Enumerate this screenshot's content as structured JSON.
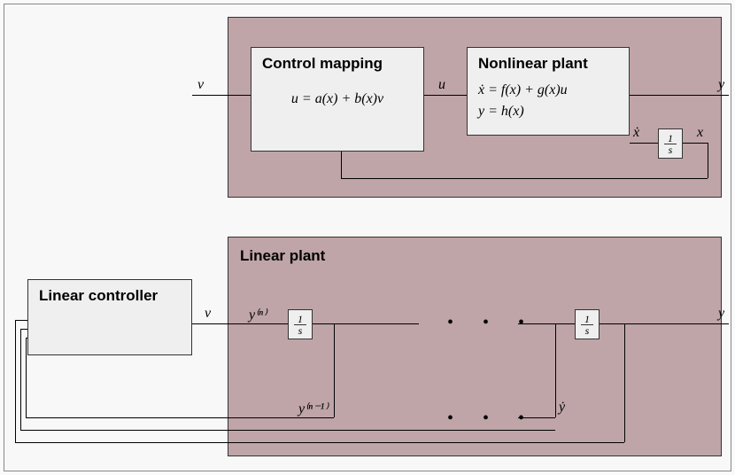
{
  "top_panel": {
    "control_mapping": {
      "title": "Control mapping",
      "equation": "u = a(x) + b(x)v"
    },
    "nonlinear_plant": {
      "title": "Nonlinear plant",
      "equation1": "ẋ = f(x) + g(x)u",
      "equation2": "y = h(x)"
    },
    "integrator": {
      "num": "1",
      "den": "s"
    },
    "signals": {
      "v": "v",
      "u": "u",
      "y": "y",
      "xdot": "ẋ",
      "x": "x"
    }
  },
  "bottom_panel": {
    "title": "Linear plant",
    "linear_controller": {
      "title": "Linear controller"
    },
    "integrator1": {
      "num": "1",
      "den": "s"
    },
    "integrator2": {
      "num": "1",
      "den": "s"
    },
    "signals": {
      "v": "v",
      "yn": "y⁽ⁿ⁾",
      "y": "y",
      "yn1": "y⁽ⁿ⁻¹⁾",
      "ydot": "ẏ"
    },
    "dots": "•  •  •"
  }
}
